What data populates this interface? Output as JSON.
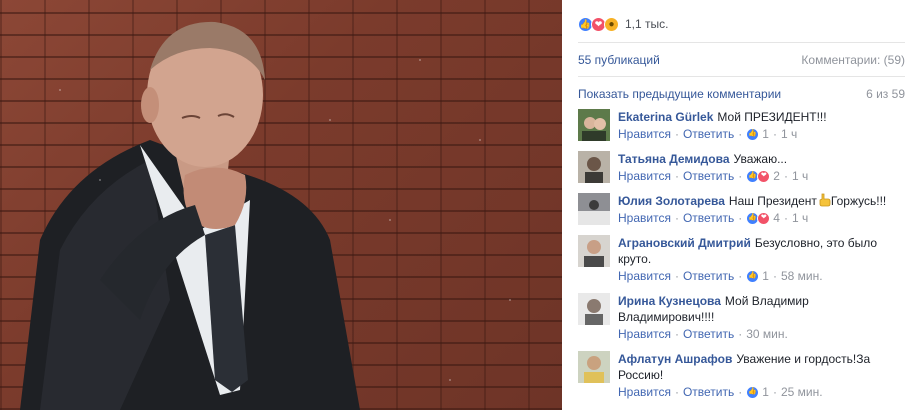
{
  "post": {
    "reactions": {
      "icons": [
        "like-icon",
        "love-icon",
        "wow-icon"
      ],
      "count": "1,1 тыс."
    },
    "publications": "55 публикаций",
    "comments_label": "Комментарии: (59)",
    "previous_comments": "Показать предыдущие комментарии",
    "pager": "6 из 59"
  },
  "actions": {
    "like": "Нравится",
    "reply": "Ответить"
  },
  "comments": [
    {
      "author": "Ekaterina Gürlek",
      "text": "Мой ПРЕЗИДЕНТ!!!",
      "reaction_count": "1",
      "time": "1 ч",
      "reactions": [
        "like"
      ]
    },
    {
      "author": "Татьяна Демидова",
      "text": "Уважаю...",
      "reaction_count": "2",
      "time": "1 ч",
      "reactions": [
        "like",
        "love"
      ]
    },
    {
      "author": "Юлия Золотарева",
      "text_before": "Наш Президент",
      "text_after": "Горжусь!!!",
      "emoji": "pointing-hand-emoji",
      "reaction_count": "4",
      "time": "1 ч",
      "reactions": [
        "like",
        "love"
      ]
    },
    {
      "author": "Аграновский Дмитрий",
      "text": "Безусловно, это было круто.",
      "reaction_count": "1",
      "time": "58 мин.",
      "reactions": [
        "like"
      ]
    },
    {
      "author": "Ирина Кузнецова",
      "text": "Мой Владимир Владимирович!!!!",
      "time": "30 мин.",
      "reactions": []
    },
    {
      "author": "Афлатун Ашрафов",
      "text": "Уважение и гордость!За Россию!",
      "reaction_count": "1",
      "time": "25 мин.",
      "reactions": [
        "like"
      ]
    }
  ],
  "colors": {
    "link": "#365899",
    "meta": "#90949c",
    "like": "#4080ff",
    "love": "#f25268",
    "wow": "#f7b125"
  }
}
